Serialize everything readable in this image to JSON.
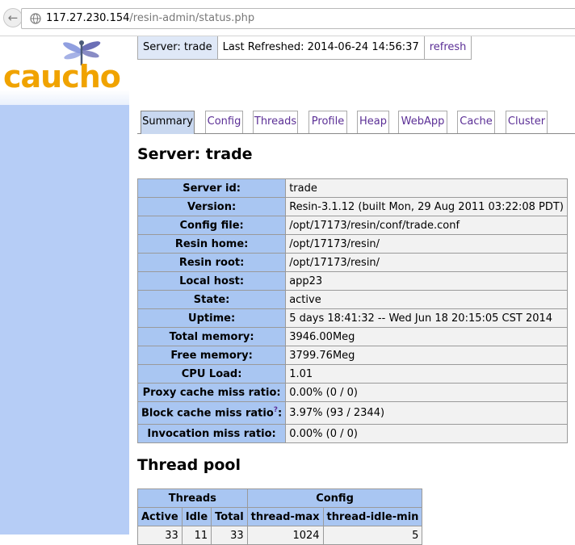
{
  "browser": {
    "url_host": "117.27.230.154",
    "url_path": "/resin-admin/status.php"
  },
  "logo": {
    "text": "caucho",
    "icon": "dragonfly-icon"
  },
  "serverbar": {
    "server": "Server: trade",
    "last_refreshed": "Last Refreshed: 2014-06-24 14:56:37",
    "refresh": "refresh"
  },
  "tabs": [
    {
      "label": "Summary",
      "active": true
    },
    {
      "label": "Config"
    },
    {
      "label": "Threads"
    },
    {
      "label": "Profile"
    },
    {
      "label": "Heap"
    },
    {
      "label": "WebApp"
    },
    {
      "label": "Cache"
    },
    {
      "label": "Cluster"
    }
  ],
  "server_title": "Server: trade",
  "summary": [
    {
      "key": "Server id:",
      "value": "trade"
    },
    {
      "key": "Version:",
      "value": "Resin-3.1.12 (built Mon, 29 Aug 2011 03:22:08 PDT)"
    },
    {
      "key": "Config file:",
      "value": "/opt/17173/resin/conf/trade.conf"
    },
    {
      "key": "Resin home:",
      "value": "/opt/17173/resin/"
    },
    {
      "key": "Resin root:",
      "value": "/opt/17173/resin/"
    },
    {
      "key": "Local host:",
      "value": "app23"
    },
    {
      "key": "State:",
      "value": "active"
    },
    {
      "key": "Uptime:",
      "value": "5 days 18:41:32 -- Wed Jun 18 20:15:05 CST 2014"
    },
    {
      "key": "Total memory:",
      "value": "3946.00Meg"
    },
    {
      "key": "Free memory:",
      "value": "3799.76Meg"
    },
    {
      "key": "CPU Load:",
      "value": "1.01"
    },
    {
      "key": "Proxy cache miss ratio:",
      "value": "0.00% (0 / 0)"
    },
    {
      "key": "Block cache miss ratio",
      "sup": "?",
      "key_suffix": ":",
      "value": "3.97% (93 / 2344)"
    },
    {
      "key": "Invocation miss ratio:",
      "value": "0.00% (0 / 0)"
    }
  ],
  "thread_pool": {
    "title": "Thread pool",
    "group_headers": [
      "Threads",
      "Config"
    ],
    "columns": [
      "Active",
      "Idle",
      "Total",
      "thread-max",
      "thread-idle-min"
    ],
    "row": [
      "33",
      "11",
      "33",
      "1024",
      "5"
    ]
  }
}
